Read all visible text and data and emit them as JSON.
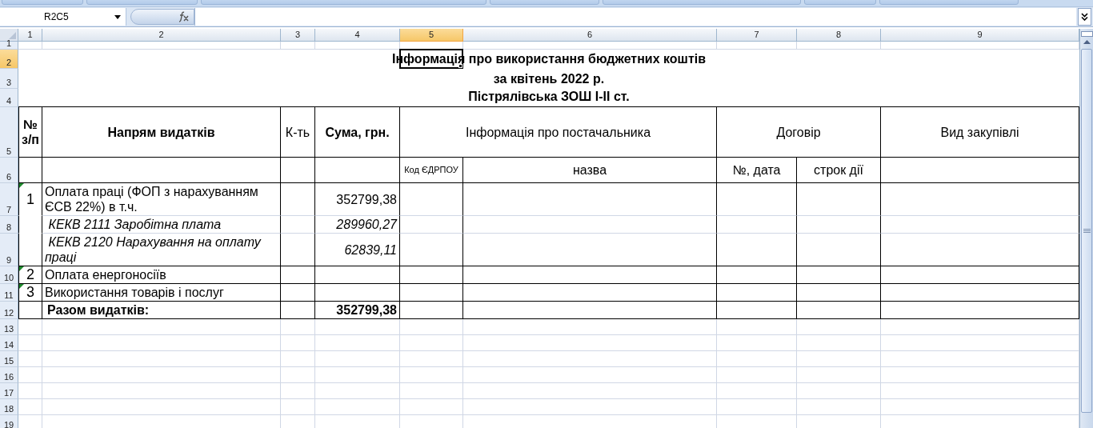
{
  "name_box": "R2C5",
  "columns": [
    {
      "label": "1",
      "selected": false
    },
    {
      "label": "2",
      "selected": false
    },
    {
      "label": "3",
      "selected": false
    },
    {
      "label": "4",
      "selected": false
    },
    {
      "label": "5",
      "selected": true
    },
    {
      "label": "6",
      "selected": false
    },
    {
      "label": "7",
      "selected": false
    },
    {
      "label": "8",
      "selected": false
    },
    {
      "label": "9",
      "selected": false
    }
  ],
  "row_headers": [
    {
      "label": "1",
      "selected": false
    },
    {
      "label": "2",
      "selected": true
    },
    {
      "label": "3",
      "selected": false
    },
    {
      "label": "4",
      "selected": false
    },
    {
      "label": "5",
      "selected": false
    },
    {
      "label": "6",
      "selected": false
    },
    {
      "label": "7",
      "selected": false
    },
    {
      "label": "8",
      "selected": false
    },
    {
      "label": "9",
      "selected": false
    },
    {
      "label": "10",
      "selected": false
    },
    {
      "label": "11",
      "selected": false
    },
    {
      "label": "12",
      "selected": false
    },
    {
      "label": "13",
      "selected": false
    },
    {
      "label": "14",
      "selected": false
    },
    {
      "label": "15",
      "selected": false
    },
    {
      "label": "16",
      "selected": false
    },
    {
      "label": "17",
      "selected": false
    },
    {
      "label": "18",
      "selected": false
    },
    {
      "label": "19",
      "selected": false
    }
  ],
  "title_lines": [
    "Інформація про використання бюджетних коштів",
    "за квітень 2022 р.",
    "Пістрялівська ЗОШ І-ІІ ст."
  ],
  "table": {
    "header": {
      "number": "№ з/п",
      "direction": "Напрям видатків",
      "qty": "К-ть",
      "sum": "Сума, грн.",
      "supplier": "Інформація про постачальника",
      "contract": "Договір",
      "purchase_type": "Вид закупівлі",
      "supplier_code": "Код ЄДРПОУ",
      "supplier_name": "назва",
      "contract_number": "№, дата",
      "contract_term": "строк дії"
    },
    "rows": [
      {
        "kind": "item",
        "flagged": true,
        "number": "1",
        "direction": "Оплата праці (ФОП з нарахуванням ЄСВ 22%) в т.ч.",
        "sum": "352799,38"
      },
      {
        "kind": "sub",
        "flagged": false,
        "direction": " КЕКВ 2111 Заробітна плата",
        "sum": "289960,27"
      },
      {
        "kind": "sub",
        "flagged": false,
        "direction": " КЕКВ 2120 Нарахування на оплату праці",
        "sum": "62839,11"
      },
      {
        "kind": "item",
        "flagged": true,
        "number": "2",
        "direction": "Оплата енергоносіїв"
      },
      {
        "kind": "item",
        "flagged": true,
        "number": "3",
        "direction": "Використання товарів і послуг"
      },
      {
        "kind": "total",
        "flagged": false,
        "direction": "Разом видатків:",
        "sum": "352799,38"
      }
    ]
  }
}
